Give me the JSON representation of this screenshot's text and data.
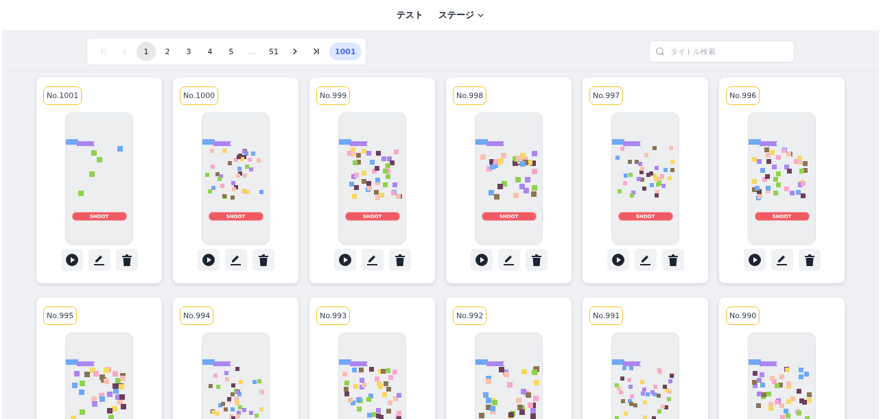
{
  "nav": {
    "items": [
      {
        "label": "テスト",
        "kind": "link"
      },
      {
        "label": "ステージ",
        "kind": "dropdown"
      }
    ]
  },
  "pagination": {
    "items": [
      {
        "kind": "first",
        "disabled": true
      },
      {
        "kind": "prev",
        "disabled": true
      },
      {
        "kind": "page",
        "label": "1",
        "selected": true
      },
      {
        "kind": "page",
        "label": "2",
        "selected": false
      },
      {
        "kind": "page",
        "label": "3",
        "selected": false
      },
      {
        "kind": "page",
        "label": "4",
        "selected": false
      },
      {
        "kind": "page",
        "label": "5",
        "selected": false
      },
      {
        "kind": "ellipsis",
        "label": "..."
      },
      {
        "kind": "page",
        "label": "51",
        "selected": false
      },
      {
        "kind": "next",
        "disabled": false
      },
      {
        "kind": "last",
        "disabled": false
      },
      {
        "kind": "total",
        "label": "1001"
      }
    ]
  },
  "search": {
    "placeholder": "タイトル検索"
  },
  "cards": [
    {
      "badge": "No.1001",
      "shoot_label": "SHOOT",
      "actions": [
        {
          "kind": "play"
        },
        {
          "kind": "edit"
        },
        {
          "kind": "delete"
        }
      ]
    },
    {
      "badge": "No.1000",
      "shoot_label": "SHOOT",
      "actions": [
        {
          "kind": "play"
        },
        {
          "kind": "edit"
        },
        {
          "kind": "delete"
        }
      ]
    },
    {
      "badge": "No.999",
      "shoot_label": "SHOOT",
      "actions": [
        {
          "kind": "play"
        },
        {
          "kind": "edit"
        },
        {
          "kind": "delete"
        }
      ]
    },
    {
      "badge": "No.998",
      "shoot_label": "SHOOT",
      "actions": [
        {
          "kind": "play"
        },
        {
          "kind": "edit"
        },
        {
          "kind": "delete"
        }
      ]
    },
    {
      "badge": "No.997",
      "shoot_label": "SHOOT",
      "actions": [
        {
          "kind": "play"
        },
        {
          "kind": "edit"
        },
        {
          "kind": "delete"
        }
      ]
    },
    {
      "badge": "No.996",
      "shoot_label": "SHOOT",
      "actions": [
        {
          "kind": "play"
        },
        {
          "kind": "edit"
        },
        {
          "kind": "delete"
        }
      ]
    },
    {
      "badge": "No.995"
    },
    {
      "badge": "No.994"
    },
    {
      "badge": "No.993"
    },
    {
      "badge": "No.992"
    },
    {
      "badge": "No.991"
    },
    {
      "badge": "No.990"
    }
  ]
}
